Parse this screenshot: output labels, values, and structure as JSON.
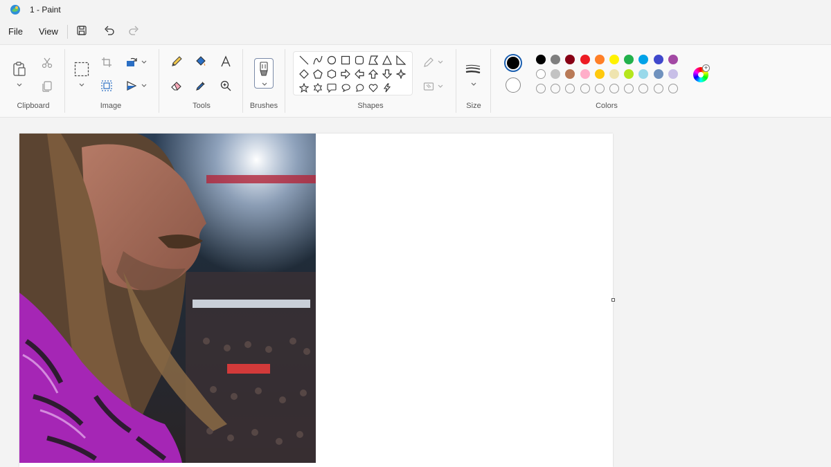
{
  "window": {
    "title": "1 - Paint"
  },
  "menu": {
    "file": "File",
    "view": "View"
  },
  "ribbon": {
    "groups": {
      "clipboard": "Clipboard",
      "image": "Image",
      "tools": "Tools",
      "brushes": "Brushes",
      "shapes": "Shapes",
      "size": "Size",
      "colors": "Colors"
    }
  },
  "palette": {
    "primary": "#000000",
    "secondary": "#ffffff",
    "row1": [
      "#000000",
      "#7f7f7f",
      "#880015",
      "#ed1c24",
      "#ff7f27",
      "#fff200",
      "#22b14c",
      "#00a2e8",
      "#3f48cc",
      "#a349a4"
    ],
    "row2": [
      "#ffffff",
      "#c3c3c3",
      "#b97a57",
      "#ffaec9",
      "#ffc90e",
      "#efe4b0",
      "#b5e61d",
      "#99d9ea",
      "#7092be",
      "#c8bfe7"
    ]
  },
  "canvas": {
    "image_description_icon": "photo-wrestler"
  }
}
